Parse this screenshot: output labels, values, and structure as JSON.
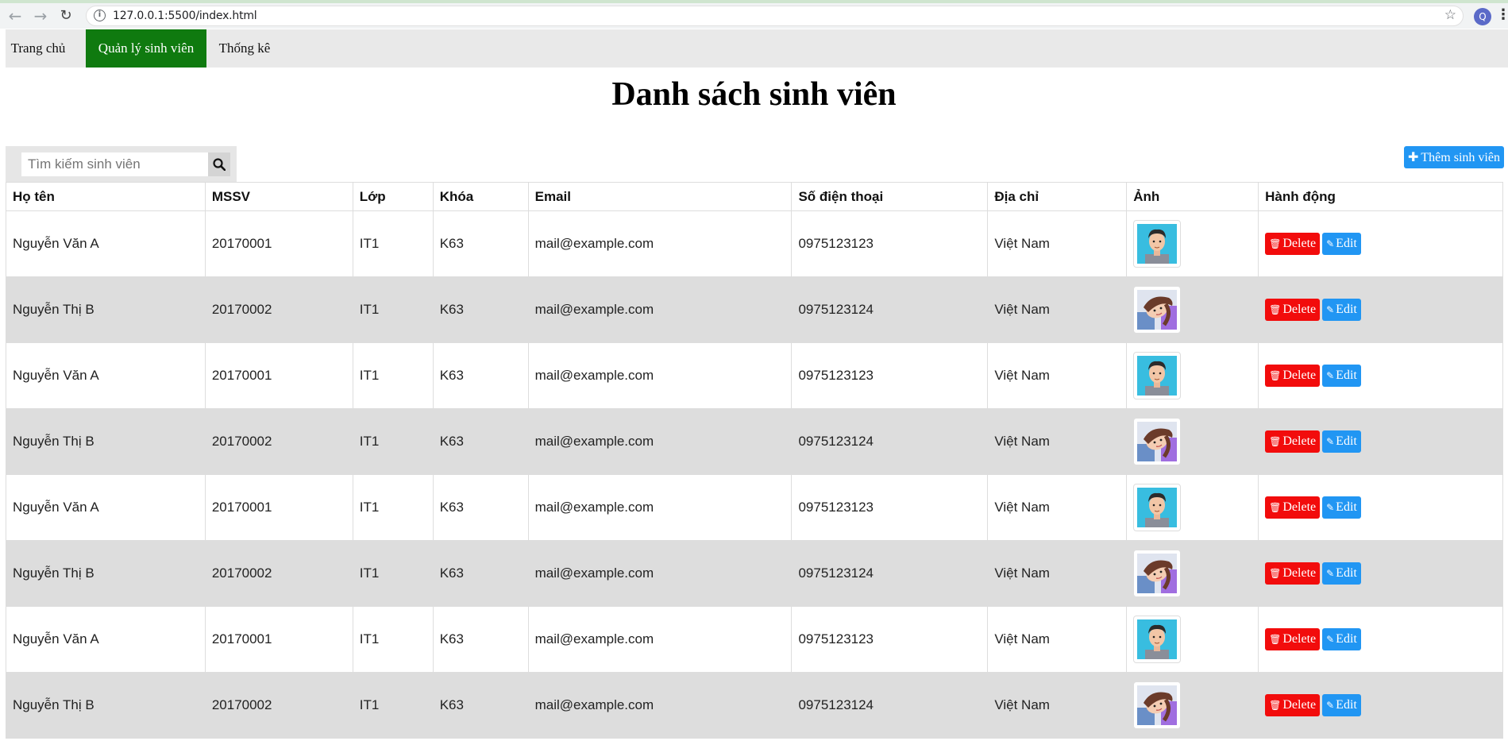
{
  "browser": {
    "url": "127.0.0.1:5500/index.html",
    "profile_initial": "Q"
  },
  "nav": {
    "items": [
      {
        "label": "Trang chủ",
        "active": false
      },
      {
        "label": "Quản lý sinh viên",
        "active": true
      },
      {
        "label": "Thống kê",
        "active": false
      }
    ]
  },
  "page": {
    "title": "Danh sách sinh viên",
    "search_placeholder": "Tìm kiếm sinh viên",
    "add_button_label": "Thêm sinh viên"
  },
  "table": {
    "headers": [
      "Họ tên",
      "MSSV",
      "Lớp",
      "Khóa",
      "Email",
      "Số điện thoại",
      "Địa chỉ",
      "Ảnh",
      "Hành động"
    ],
    "delete_label": "Delete",
    "edit_label": "Edit",
    "rows": [
      {
        "name": "Nguyễn Văn A",
        "mssv": "20170001",
        "lop": "IT1",
        "khoa": "K63",
        "email": "mail@example.com",
        "phone": "0975123123",
        "address": "Việt Nam",
        "avatar": "male-avatar"
      },
      {
        "name": "Nguyễn Thị B",
        "mssv": "20170002",
        "lop": "IT1",
        "khoa": "K63",
        "email": "mail@example.com",
        "phone": "0975123124",
        "address": "Việt Nam",
        "avatar": "female-avatar"
      },
      {
        "name": "Nguyễn Văn A",
        "mssv": "20170001",
        "lop": "IT1",
        "khoa": "K63",
        "email": "mail@example.com",
        "phone": "0975123123",
        "address": "Việt Nam",
        "avatar": "male-avatar"
      },
      {
        "name": "Nguyễn Thị B",
        "mssv": "20170002",
        "lop": "IT1",
        "khoa": "K63",
        "email": "mail@example.com",
        "phone": "0975123124",
        "address": "Việt Nam",
        "avatar": "female-avatar"
      },
      {
        "name": "Nguyễn Văn A",
        "mssv": "20170001",
        "lop": "IT1",
        "khoa": "K63",
        "email": "mail@example.com",
        "phone": "0975123123",
        "address": "Việt Nam",
        "avatar": "male-avatar"
      },
      {
        "name": "Nguyễn Thị B",
        "mssv": "20170002",
        "lop": "IT1",
        "khoa": "K63",
        "email": "mail@example.com",
        "phone": "0975123124",
        "address": "Việt Nam",
        "avatar": "female-avatar"
      },
      {
        "name": "Nguyễn Văn A",
        "mssv": "20170001",
        "lop": "IT1",
        "khoa": "K63",
        "email": "mail@example.com",
        "phone": "0975123123",
        "address": "Việt Nam",
        "avatar": "male-avatar"
      },
      {
        "name": "Nguyễn Thị B",
        "mssv": "20170002",
        "lop": "IT1",
        "khoa": "K63",
        "email": "mail@example.com",
        "phone": "0975123124",
        "address": "Việt Nam",
        "avatar": "female-avatar"
      }
    ]
  },
  "colors": {
    "nav_active": "#0f7a0f",
    "delete": "#f20c0c",
    "edit": "#2196f3",
    "row_alt": "#dddddd"
  }
}
